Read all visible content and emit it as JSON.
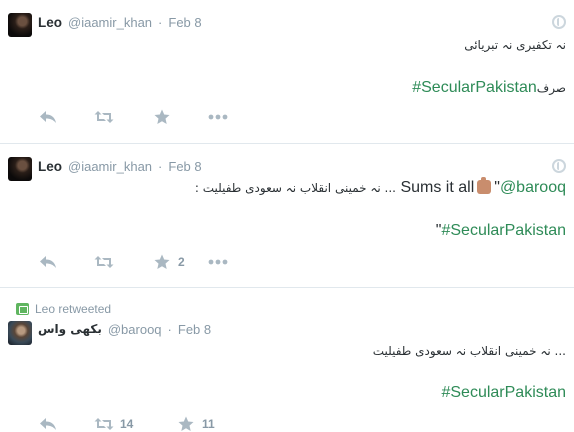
{
  "tweets": [
    {
      "author": {
        "name": "Leo",
        "handle": "@iaamir_khan"
      },
      "time": "Feb 8",
      "line1": "نہ تکفیری نہ تبریائی",
      "line2_prefix": "صرف ",
      "line2_hashtag": "#SecularPakistan",
      "actions": {
        "reply_icon": "reply-icon",
        "retweet_icon": "retweet-icon",
        "favorite_icon": "star-icon",
        "more_icon": "more-icon"
      }
    },
    {
      "author": {
        "name": "Leo",
        "handle": "@iaamir_khan"
      },
      "time": "Feb 8",
      "mention": "@barooq",
      "quote_open": "\"",
      "sums": " Sums it all",
      "quoted_text": ": نہ خمینی انقلاب نہ سعودی طفیلیت ...",
      "line2_hashtag": "#SecularPakistan",
      "line2_suffix": "\"",
      "favorite_count": "2"
    },
    {
      "retweeted_by": "Leo retweeted",
      "author": {
        "name": "بکھی واس",
        "handle": "@barooq"
      },
      "time": "Feb 8",
      "line1": "نہ خمینی انقلاب نہ سعودی طفیلیت ...",
      "line2_hashtag": "#SecularPakistan",
      "retweet_count": "14",
      "favorite_count": "11"
    }
  ],
  "colors": {
    "hashtag": "#2e8b57",
    "meta": "#8899a6",
    "icon": "#aab8c2",
    "divider": "#e1e8ed",
    "retweet_badge": "#5fb55f"
  }
}
